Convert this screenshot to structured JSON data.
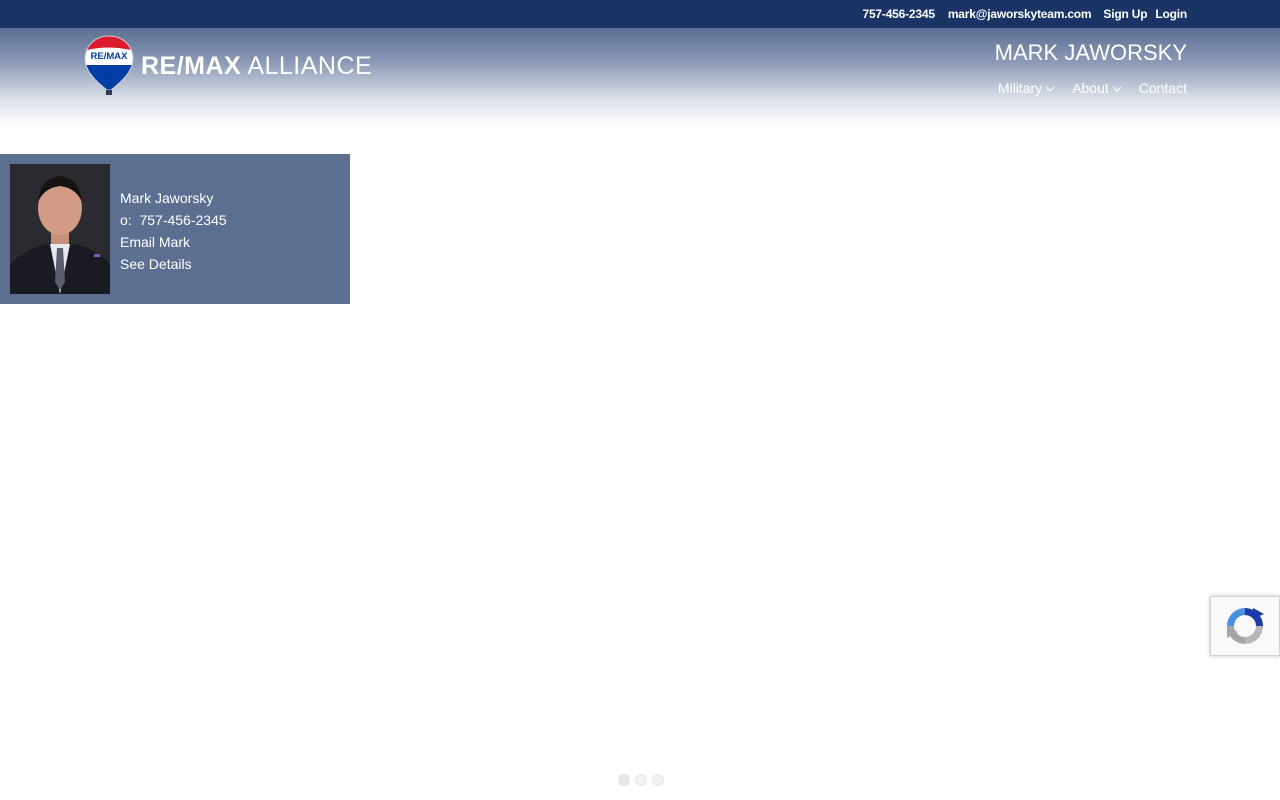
{
  "topbar": {
    "phone": "757-456-2345",
    "email": "mark@jaworskyteam.com",
    "signup": "Sign Up",
    "login": "Login"
  },
  "header": {
    "logo_text_bold": "RE/MAX",
    "logo_text_light": "ALLIANCE",
    "balloon_text": "RE/MAX",
    "agent_name": "MARK JAWORSKY",
    "nav": [
      {
        "label": "Military",
        "has_dropdown": true
      },
      {
        "label": "About",
        "has_dropdown": true
      },
      {
        "label": "Contact",
        "has_dropdown": false
      }
    ]
  },
  "agent_card": {
    "name": "Mark Jaworsky",
    "office_prefix": "o:",
    "office_phone": "757-456-2345",
    "email_link": "Email Mark",
    "details_link": "See Details"
  },
  "carousel": {
    "dot_count": 3,
    "active_index": 0
  },
  "colors": {
    "topbar": "#1b3466",
    "card": "#5c6f91",
    "balloon_red": "#dc1c2e",
    "balloon_blue": "#003da5"
  },
  "icons": {
    "nav_dropdown": "chevron-down-icon",
    "recaptcha": "recaptcha-icon"
  }
}
